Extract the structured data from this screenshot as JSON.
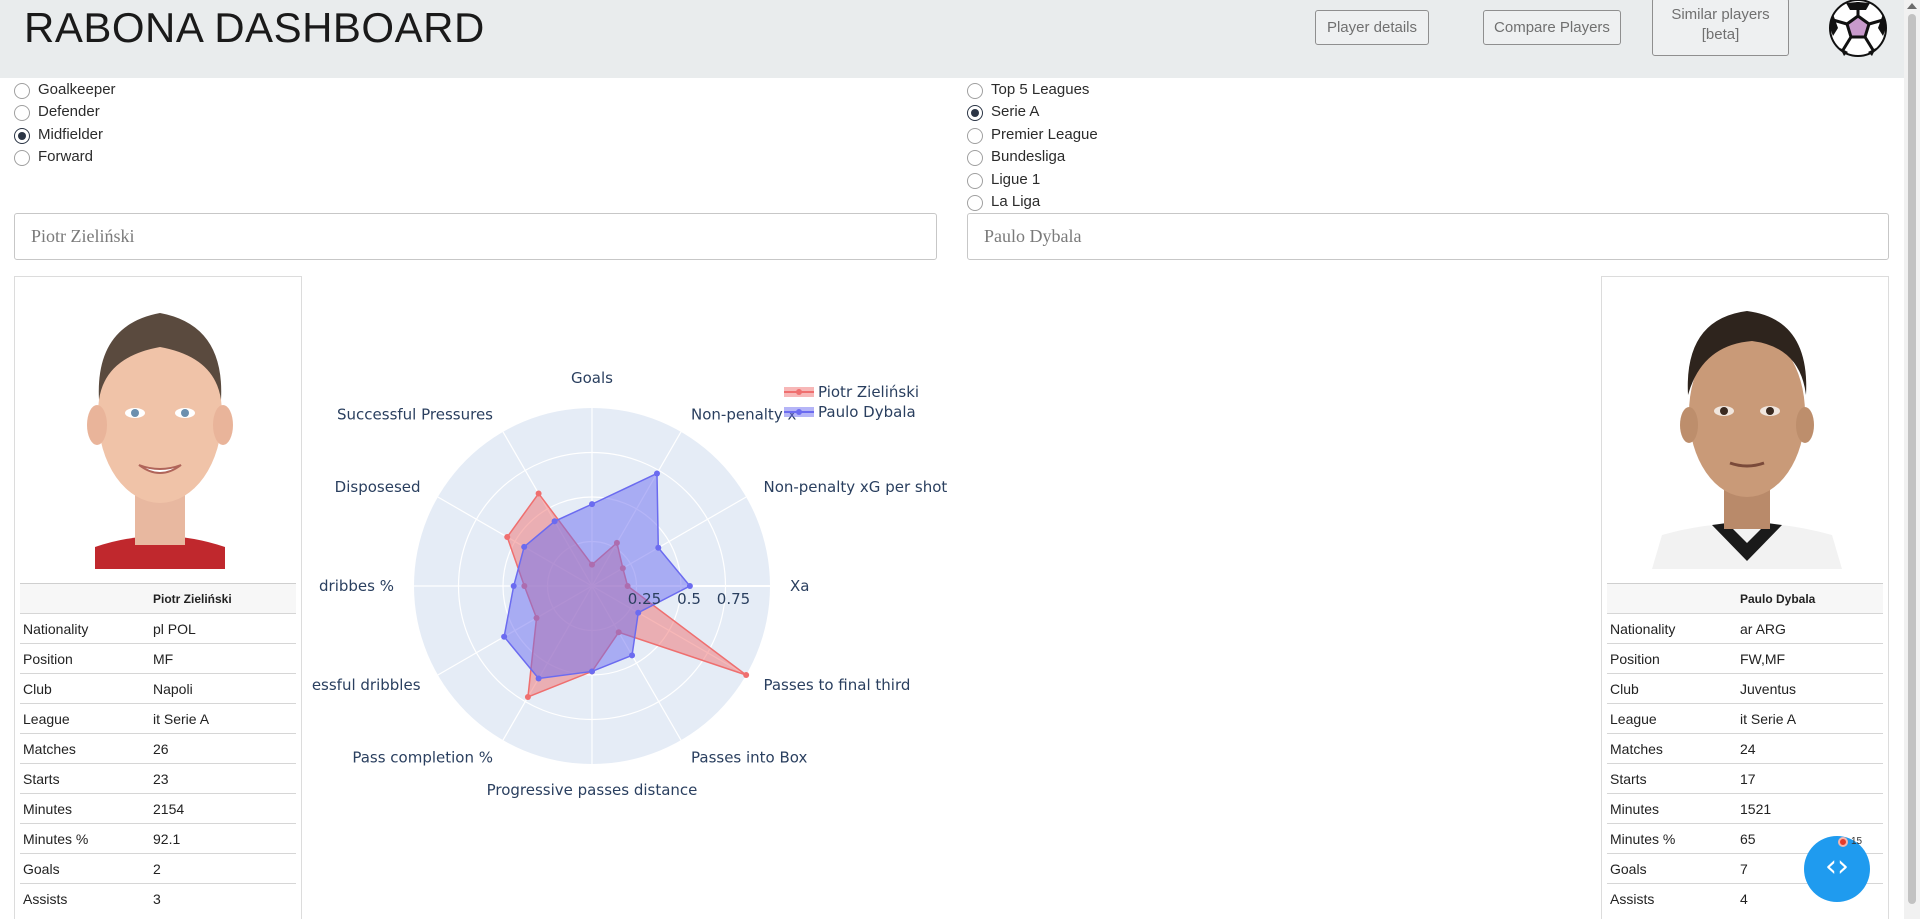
{
  "header": {
    "title": "RABONA DASHBOARD",
    "buttons": [
      {
        "label": "Player details"
      },
      {
        "label": "Compare Players"
      },
      {
        "label_line1": "Similar players",
        "label_line2": "[beta]"
      }
    ],
    "logo_icon": "soccer-ball-icon"
  },
  "positions": {
    "options": [
      "Goalkeeper",
      "Defender",
      "Midfielder",
      "Forward"
    ],
    "selected": "Midfielder"
  },
  "leagues": {
    "options": [
      "Top 5 Leagues",
      "Serie A",
      "Premier League",
      "Bundesliga",
      "Ligue 1",
      "La Liga"
    ],
    "selected": "Serie A"
  },
  "player1": {
    "input_value": "Piotr Zieliński",
    "table_header": "Piotr Zieliński",
    "rows": [
      {
        "key": "Nationality",
        "value": "pl POL"
      },
      {
        "key": "Position",
        "value": "MF"
      },
      {
        "key": "Club",
        "value": "Napoli"
      },
      {
        "key": "League",
        "value": "it Serie A"
      },
      {
        "key": "Matches",
        "value": "26"
      },
      {
        "key": "Starts",
        "value": "23"
      },
      {
        "key": "Minutes",
        "value": "2154"
      },
      {
        "key": "Minutes %",
        "value": "92.1"
      },
      {
        "key": "Goals",
        "value": "2"
      },
      {
        "key": "Assists",
        "value": "3"
      }
    ]
  },
  "player2": {
    "input_value": "Paulo Dybala",
    "table_header": "Paulo Dybala",
    "rows": [
      {
        "key": "Nationality",
        "value": "ar ARG"
      },
      {
        "key": "Position",
        "value": "FW,MF"
      },
      {
        "key": "Club",
        "value": "Juventus"
      },
      {
        "key": "League",
        "value": "it Serie A"
      },
      {
        "key": "Matches",
        "value": "24"
      },
      {
        "key": "Starts",
        "value": "17"
      },
      {
        "key": "Minutes",
        "value": "1521"
      },
      {
        "key": "Minutes %",
        "value": "65"
      },
      {
        "key": "Goals",
        "value": "7"
      },
      {
        "key": "Assists",
        "value": "4"
      }
    ]
  },
  "chart_data": {
    "type": "radar",
    "categories": [
      "Goals",
      "Non-penalty x",
      "Non-penalty xG per shot",
      "Xa",
      "Passes to final third",
      "Passes into Box",
      "Progressive passes distance",
      "Pass completion %",
      "essful dribbles",
      "dribbes %",
      "Disposesed",
      "Successful Pressures"
    ],
    "radial_ticks": [
      "0.25",
      "0.5",
      "0.75"
    ],
    "radial_range": [
      0,
      1
    ],
    "series": [
      {
        "name": "Piotr Zieliński",
        "color": "#ef6f6f",
        "values": [
          0.12,
          0.28,
          0.2,
          0.2,
          1.0,
          0.3,
          0.48,
          0.72,
          0.36,
          0.38,
          0.55,
          0.6
        ]
      },
      {
        "name": "Paulo Dybala",
        "color": "#6b6bf0",
        "values": [
          0.46,
          0.73,
          0.43,
          0.55,
          0.3,
          0.45,
          0.48,
          0.6,
          0.57,
          0.44,
          0.44,
          0.42
        ]
      }
    ],
    "legend_position": "top-right"
  },
  "fab": {
    "icon": "code-brackets-icon",
    "badge_count": "15"
  }
}
